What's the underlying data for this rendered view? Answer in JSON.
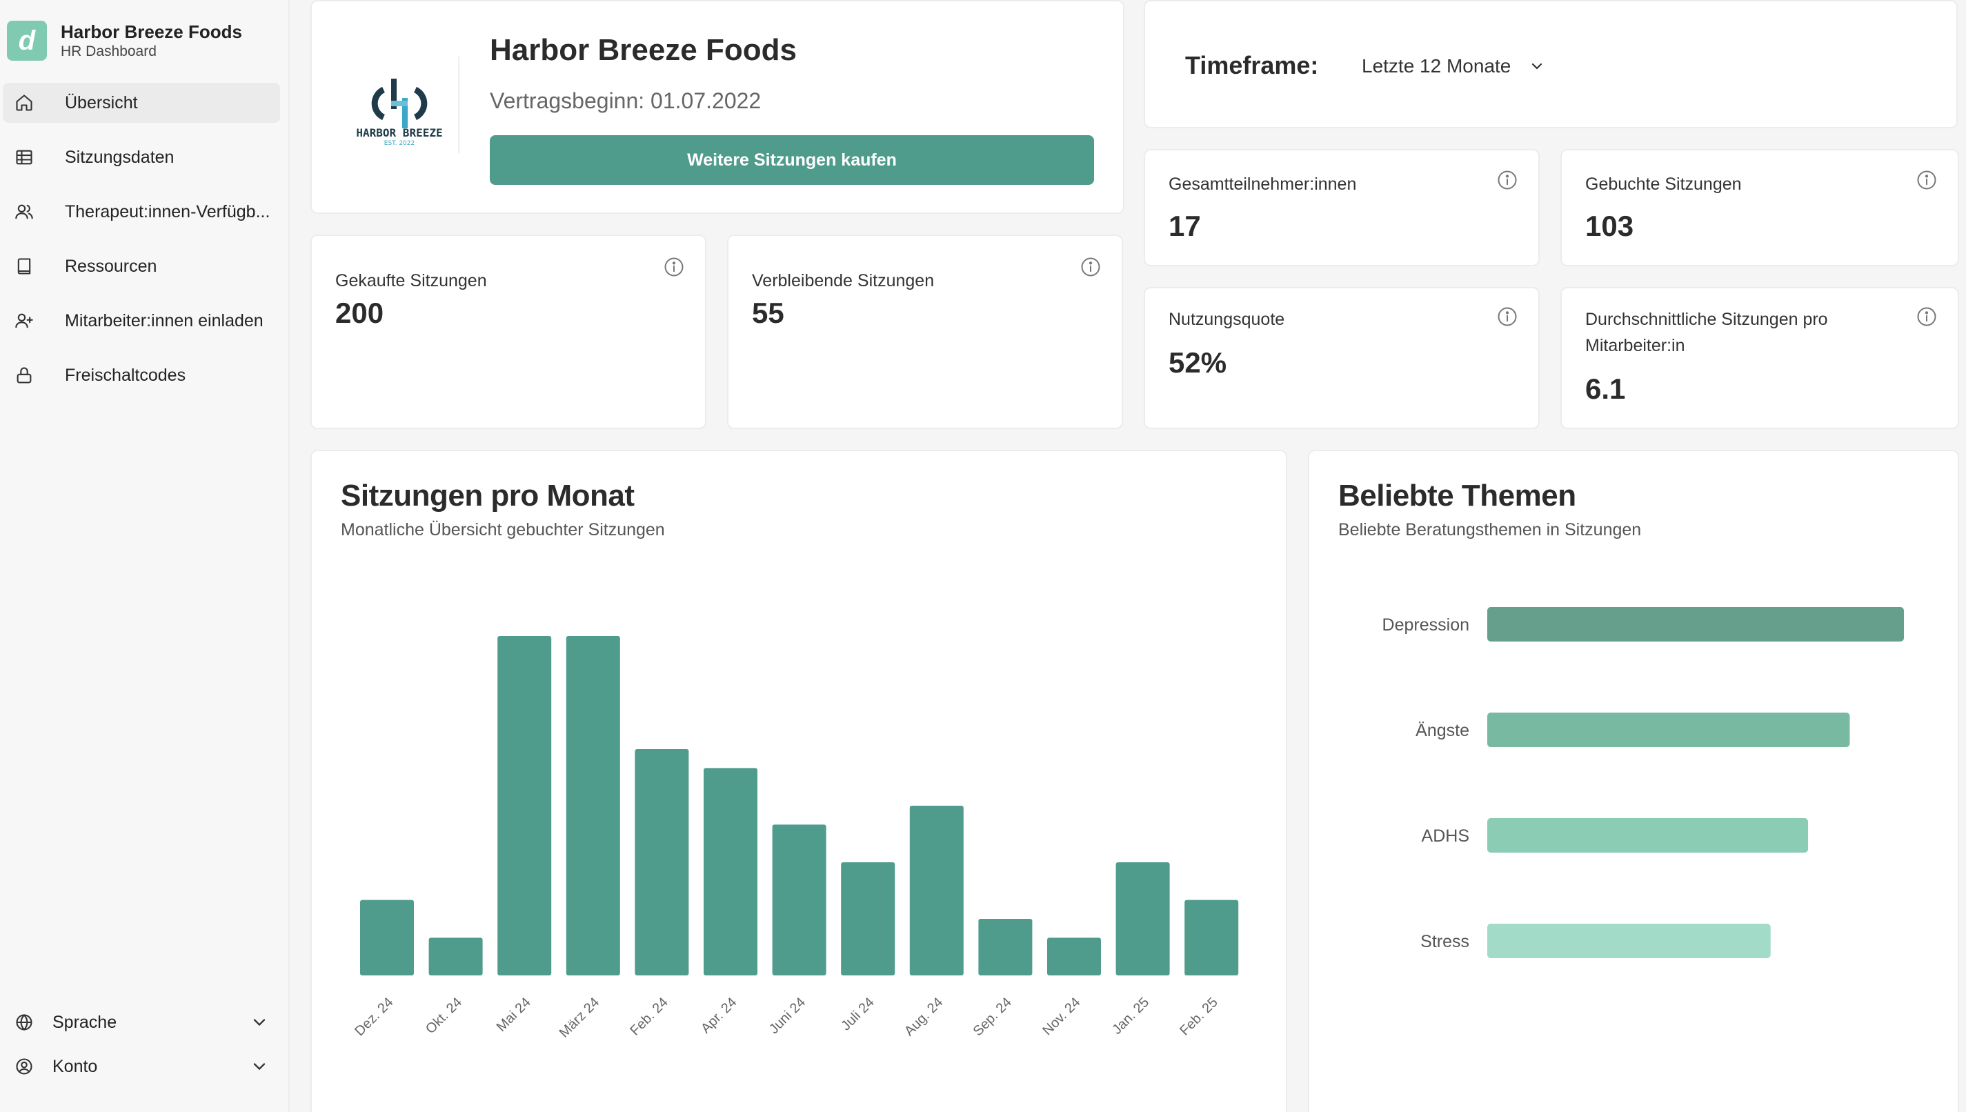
{
  "sidebar": {
    "brand_logo_letter": "d",
    "brand_name": "Harbor Breeze Foods",
    "brand_sub": "HR Dashboard",
    "items": [
      {
        "label": "Übersicht",
        "icon": "home-icon"
      },
      {
        "label": "Sitzungsdaten",
        "icon": "table-icon"
      },
      {
        "label": "Therapeut:innen-Verfügb...",
        "icon": "users-icon"
      },
      {
        "label": "Ressourcen",
        "icon": "book-icon"
      },
      {
        "label": "Mitarbeiter:innen einladen",
        "icon": "user-plus-icon"
      },
      {
        "label": "Freischaltcodes",
        "icon": "lock-icon"
      }
    ],
    "language_label": "Sprache",
    "account_label": "Konto"
  },
  "company": {
    "name": "Harbor Breeze Foods",
    "contract": "Vertragsbeginn: 01.07.2022",
    "buy_label": "Weitere Sitzungen kaufen",
    "logo_text": "HARBOR BREEZE",
    "logo_est": "EST. 2022"
  },
  "timeframe": {
    "label": "Timeframe:",
    "value": "Letzte 12 Monate"
  },
  "stats": {
    "purchased": {
      "label": "Gekaufte Sitzungen",
      "value": "200"
    },
    "remaining": {
      "label": "Verbleibende Sitzungen",
      "value": "55"
    },
    "participants": {
      "label": "Gesamtteilnehmer:innen",
      "value": "17"
    },
    "booked": {
      "label": "Gebuchte Sitzungen",
      "value": "103"
    },
    "usage": {
      "label": "Nutzungsquote",
      "value": "52%"
    },
    "average": {
      "label_line1": "Durchschnittliche Sitzungen pro",
      "label_line2": "Mitarbeiter:in",
      "value": "6.1"
    }
  },
  "sessions_chart": {
    "title": "Sitzungen pro Monat",
    "subtitle": "Monatliche Übersicht gebuchter Sitzungen"
  },
  "topics_chart": {
    "title": "Beliebte Themen",
    "subtitle": "Beliebte Beratungsthemen in Sitzungen"
  },
  "colors": {
    "accent": "#4f9b8c",
    "brand_logo": "#7fcab1",
    "topic_bars": [
      "#66a08c",
      "#77b9a1",
      "#8bccb4",
      "#a2dcc8"
    ]
  },
  "chart_data": [
    {
      "type": "bar",
      "categories": [
        "Dez. 24",
        "Okt. 24",
        "Mai 24",
        "März 24",
        "Feb. 24",
        "Apr. 24",
        "Juni 24",
        "Juli 24",
        "Aug. 24",
        "Sep. 24",
        "Nov. 24",
        "Jan. 25",
        "Feb. 25"
      ],
      "values": [
        4,
        2,
        18,
        18,
        12,
        11,
        8,
        6,
        9,
        3,
        2,
        6,
        4
      ],
      "ylim": [
        0,
        18
      ],
      "grid": false,
      "title": "Sitzungen pro Monat"
    },
    {
      "type": "bar",
      "orientation": "horizontal",
      "categories": [
        "Depression",
        "Ängste",
        "ADHS",
        "Stress"
      ],
      "values": [
        100,
        87,
        77,
        68
      ],
      "grid": false,
      "title": "Beliebte Themen"
    }
  ]
}
